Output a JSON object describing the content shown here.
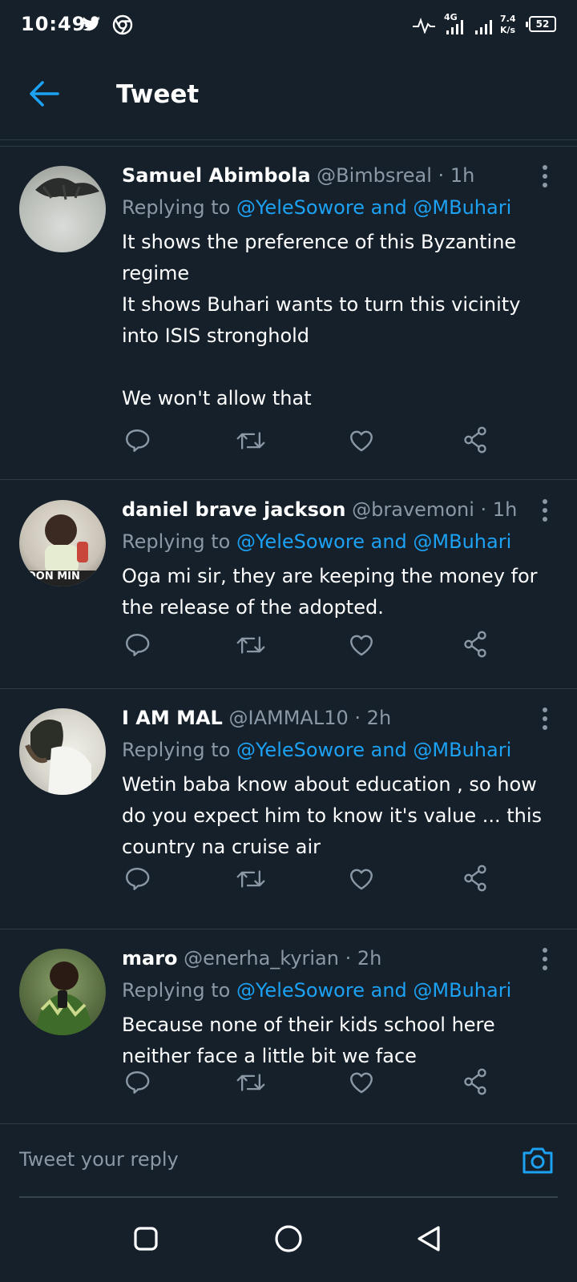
{
  "status_bar": {
    "time": "10:49",
    "network_label": "4G",
    "speed_value": "7.4",
    "speed_unit": "K/s",
    "battery": "52",
    "icons": [
      "twitter-icon",
      "chrome-icon",
      "activity-icon",
      "signal-icon",
      "signal-icon"
    ]
  },
  "header": {
    "title": "Tweet",
    "back_icon": "back-arrow-icon"
  },
  "colors": {
    "background": "#15202b",
    "accent": "#1da1f2",
    "secondary_text": "#8b98a5",
    "divider": "#2f3b47"
  },
  "tweets": [
    {
      "name": "Samuel Abimbola",
      "handle": "@Bimbsreal",
      "time": "1h",
      "replying_prefix": "Replying to",
      "mention1": "@YeleSowore",
      "and": "and",
      "mention2": "@MBuhari",
      "text": "It shows the preference of this Byzantine regime\nIt shows Buhari wants to turn this vicinity into ISIS stronghold\n\nWe won't allow that"
    },
    {
      "name": "daniel brave jackson",
      "handle": "@bravemoni",
      "time": "1h",
      "replying_prefix": "Replying to",
      "mention1": "@YeleSowore",
      "and": "and",
      "mention2": "@MBuhari",
      "text": "Oga mi sir, they are keeping the money for the release of the adopted.",
      "avatar_caption": "DON MIN"
    },
    {
      "name": "I AM MAL",
      "handle": "@IAMMAL10",
      "time": "2h",
      "replying_prefix": "Replying to",
      "mention1": "@YeleSowore",
      "and": "and",
      "mention2": "@MBuhari",
      "text": "Wetin baba know about education , so how do you expect him to know it's value ... this country na cruise air"
    },
    {
      "name": "maro",
      "handle": "@enerha_kyrian",
      "time": "2h",
      "replying_prefix": "Replying to",
      "mention1": "@YeleSowore",
      "and": "and",
      "mention2": "@MBuhari",
      "text": "Because none of their kids school here neither face a little bit we face"
    }
  ],
  "actions": [
    "reply-icon",
    "retweet-icon",
    "like-icon",
    "share-icon"
  ],
  "reply_bar": {
    "placeholder": "Tweet your reply",
    "camera_icon": "camera-icon"
  },
  "nav": {
    "icons": [
      "recent-apps-icon",
      "home-icon",
      "back-icon"
    ]
  }
}
